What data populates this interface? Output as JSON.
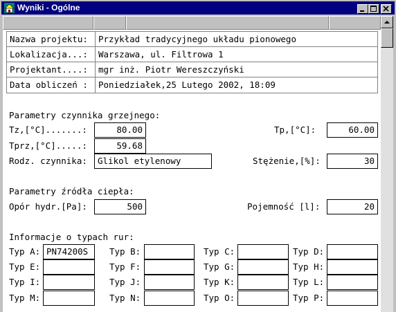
{
  "window": {
    "title": "Wyniki - Ogólne"
  },
  "project": {
    "rows": [
      {
        "label": "Nazwa projektu:",
        "value": "Przykład tradycyjnego układu pionowego"
      },
      {
        "label": "Lokalizacja...:",
        "value": "Warszawa, ul. Filtrowa 1"
      },
      {
        "label": "Projektant....:",
        "value": "mgr inż. Piotr Wereszczyński"
      },
      {
        "label": "Data obliczeń :",
        "value": "Poniedziałek,25 Lutego 2002, 18:09"
      }
    ]
  },
  "heating_medium": {
    "heading": "Parametry czynnika grzejnego:",
    "tz_label": "Tz,[°C].......:",
    "tz_value": "80.00",
    "tp_label": "Tp,[°C]:",
    "tp_value": "60.00",
    "tprz_label": "Tprz,[°C].....:",
    "tprz_value": "59.68",
    "type_label": "Rodz. czynnika:",
    "type_value": "Glikol etylenowy",
    "conc_label": "Stężenie,[%]:",
    "conc_value": "30"
  },
  "heat_source": {
    "heading": "Parametry źródła ciepła:",
    "resistance_label": "Opór hydr.[Pa]:",
    "resistance_value": "500",
    "capacity_label": "Pojemność [l]:",
    "capacity_value": "20"
  },
  "pipes": {
    "heading": "Informacje o typach rur:",
    "types": [
      {
        "label": "Typ A:",
        "value": "PN74200S"
      },
      {
        "label": "Typ B:",
        "value": ""
      },
      {
        "label": "Typ C:",
        "value": ""
      },
      {
        "label": "Typ D:",
        "value": ""
      },
      {
        "label": "Typ E:",
        "value": ""
      },
      {
        "label": "Typ F:",
        "value": ""
      },
      {
        "label": "Typ G:",
        "value": ""
      },
      {
        "label": "Typ H:",
        "value": ""
      },
      {
        "label": "Typ I:",
        "value": ""
      },
      {
        "label": "Typ J:",
        "value": ""
      },
      {
        "label": "Typ K:",
        "value": ""
      },
      {
        "label": "Typ L:",
        "value": ""
      },
      {
        "label": "Typ M:",
        "value": ""
      },
      {
        "label": "Typ N:",
        "value": ""
      },
      {
        "label": "Typ O:",
        "value": ""
      },
      {
        "label": "Typ P:",
        "value": ""
      }
    ]
  },
  "colors": {
    "titlebar": "#000080",
    "face": "#c0c0c0",
    "client": "#ffffff"
  },
  "icons": [
    "app-icon",
    "minimize-icon",
    "maximize-icon",
    "close-icon",
    "scroll-up-icon"
  ]
}
